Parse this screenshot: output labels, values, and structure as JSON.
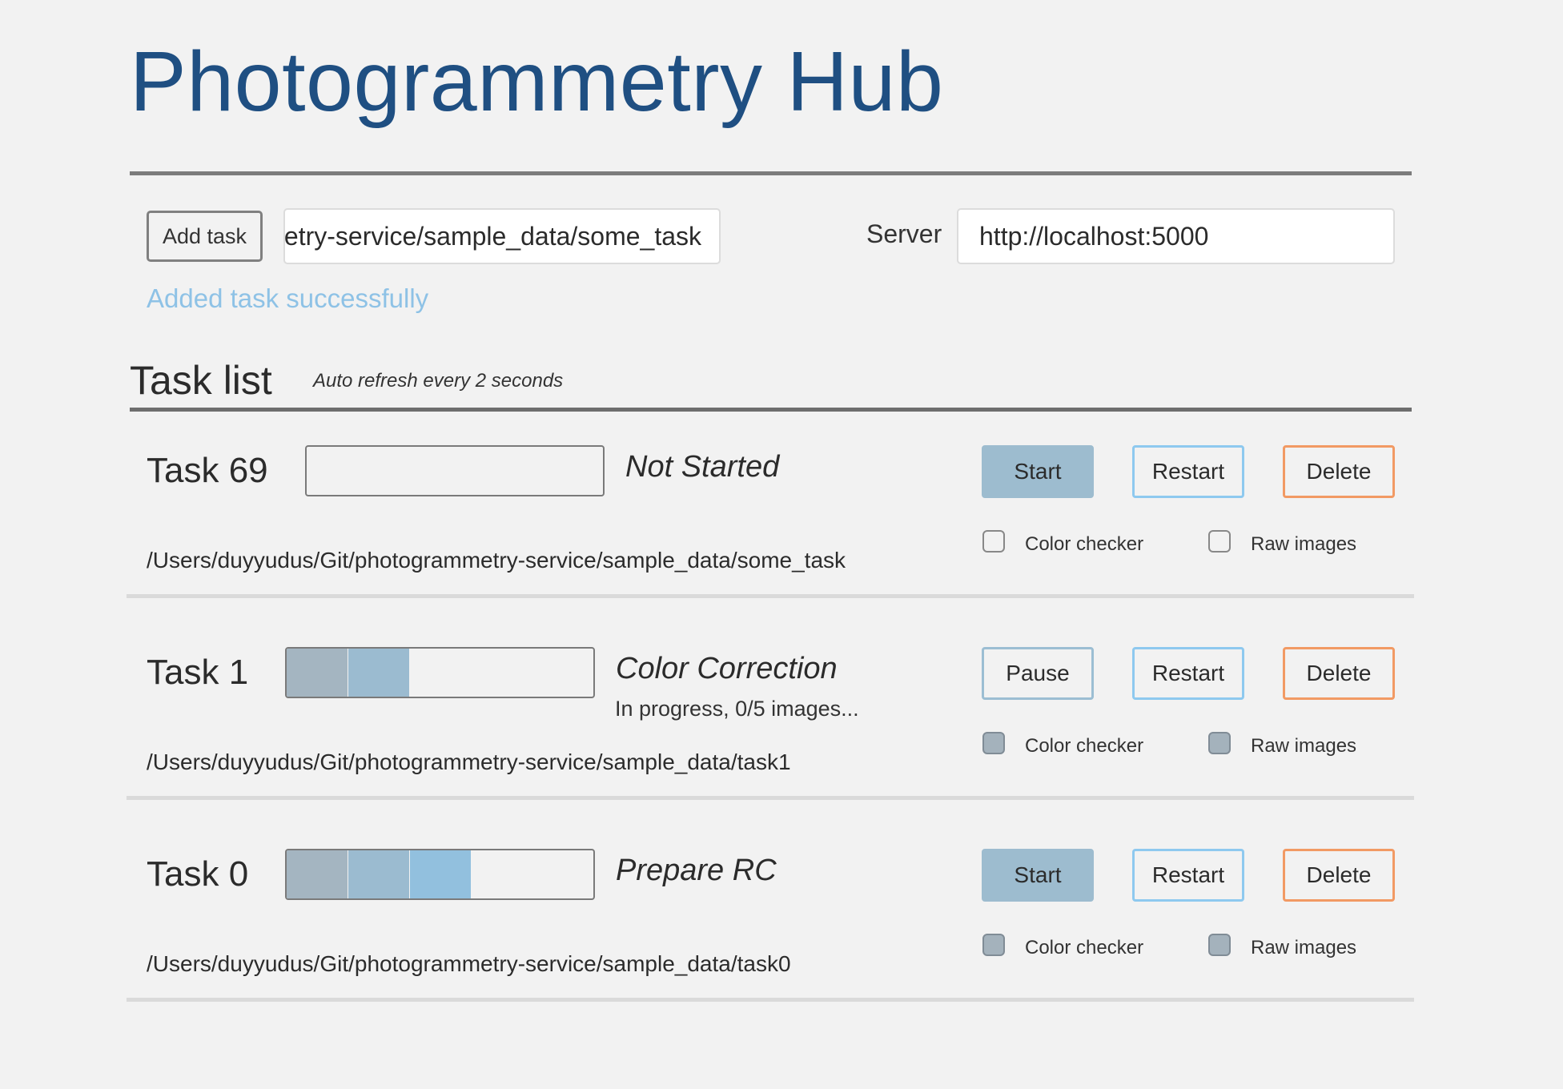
{
  "header": {
    "title": "Photogrammetry Hub"
  },
  "add_task": {
    "button_label": "Add task",
    "path_value": "/Users/duyyudus/Git/photogrammetry-service/sample_data/some_task",
    "server_label": "Server",
    "server_value": "http://localhost:5000",
    "message": "Added task successfully"
  },
  "task_list": {
    "heading": "Task list",
    "refresh_note": "Auto refresh every 2 seconds",
    "tasks": [
      {
        "name": "Task 69",
        "stage": "Not Started",
        "substatus": "",
        "progress_steps_done": 0,
        "path": "/Users/duyyudus/Git/photogrammetry-service/sample_data/some_task",
        "primary_action": "Start",
        "restart_label": "Restart",
        "delete_label": "Delete",
        "color_checker_label": "Color checker",
        "raw_images_label": "Raw images",
        "color_checker_checked": false,
        "raw_images_checked": false,
        "options_disabled": false
      },
      {
        "name": "Task 1",
        "stage": "Color Correction",
        "substatus": "In progress, 0/5 images...",
        "progress_steps_done": 2,
        "path": "/Users/duyyudus/Git/photogrammetry-service/sample_data/task1",
        "primary_action": "Pause",
        "restart_label": "Restart",
        "delete_label": "Delete",
        "color_checker_label": "Color checker",
        "raw_images_label": "Raw images",
        "color_checker_checked": false,
        "raw_images_checked": false,
        "options_disabled": true
      },
      {
        "name": "Task 0",
        "stage": "Prepare RC",
        "substatus": "",
        "progress_steps_done": 3,
        "path": "/Users/duyyudus/Git/photogrammetry-service/sample_data/task0",
        "primary_action": "Start",
        "restart_label": "Restart",
        "delete_label": "Delete",
        "color_checker_label": "Color checker",
        "raw_images_label": "Raw images",
        "color_checker_checked": false,
        "raw_images_checked": false,
        "options_disabled": true
      }
    ]
  },
  "colors": {
    "title": "#1f4f82",
    "success_message": "#8ec2e6",
    "start_button": "#9dbccf",
    "restart_border": "#8ec9ef",
    "delete_border": "#f29a64"
  }
}
